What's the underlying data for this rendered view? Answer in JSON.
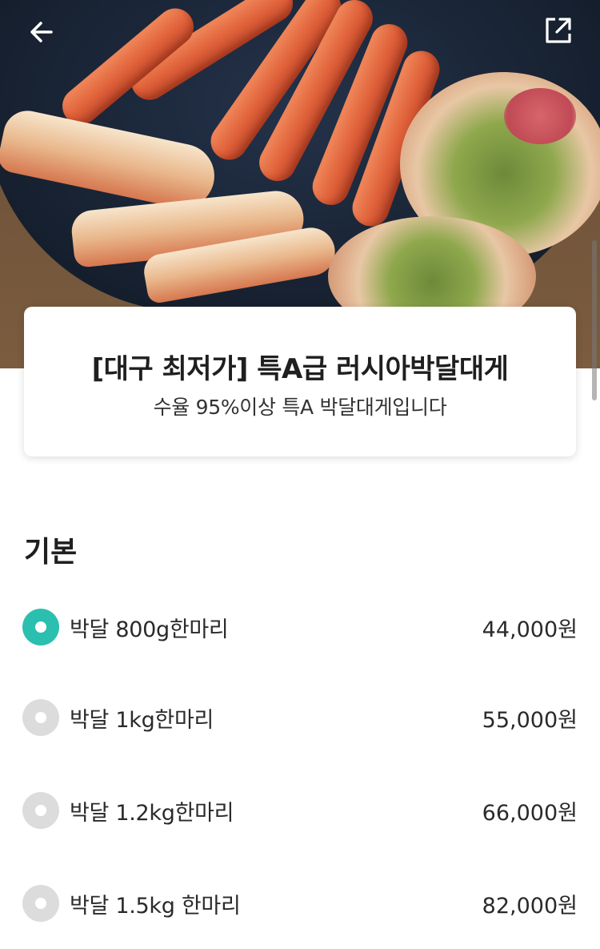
{
  "header": {
    "back_icon": "arrow-left-icon",
    "share_icon": "share-external-icon"
  },
  "product": {
    "title": "[대구 최저가] 특A급 러시아박달대게",
    "subtitle": "수율 95%이상 특A 박달대게입니다"
  },
  "options": {
    "section_title": "기본",
    "accent_color": "#2bbfaf",
    "items": [
      {
        "label": "박달 800g한마리",
        "price": "44,000원",
        "selected": true
      },
      {
        "label": "박달 1kg한마리",
        "price": "55,000원",
        "selected": false
      },
      {
        "label": "박달 1.2kg한마리",
        "price": "66,000원",
        "selected": false
      },
      {
        "label": "박달 1.5kg 한마리",
        "price": "82,000원",
        "selected": false
      }
    ]
  }
}
